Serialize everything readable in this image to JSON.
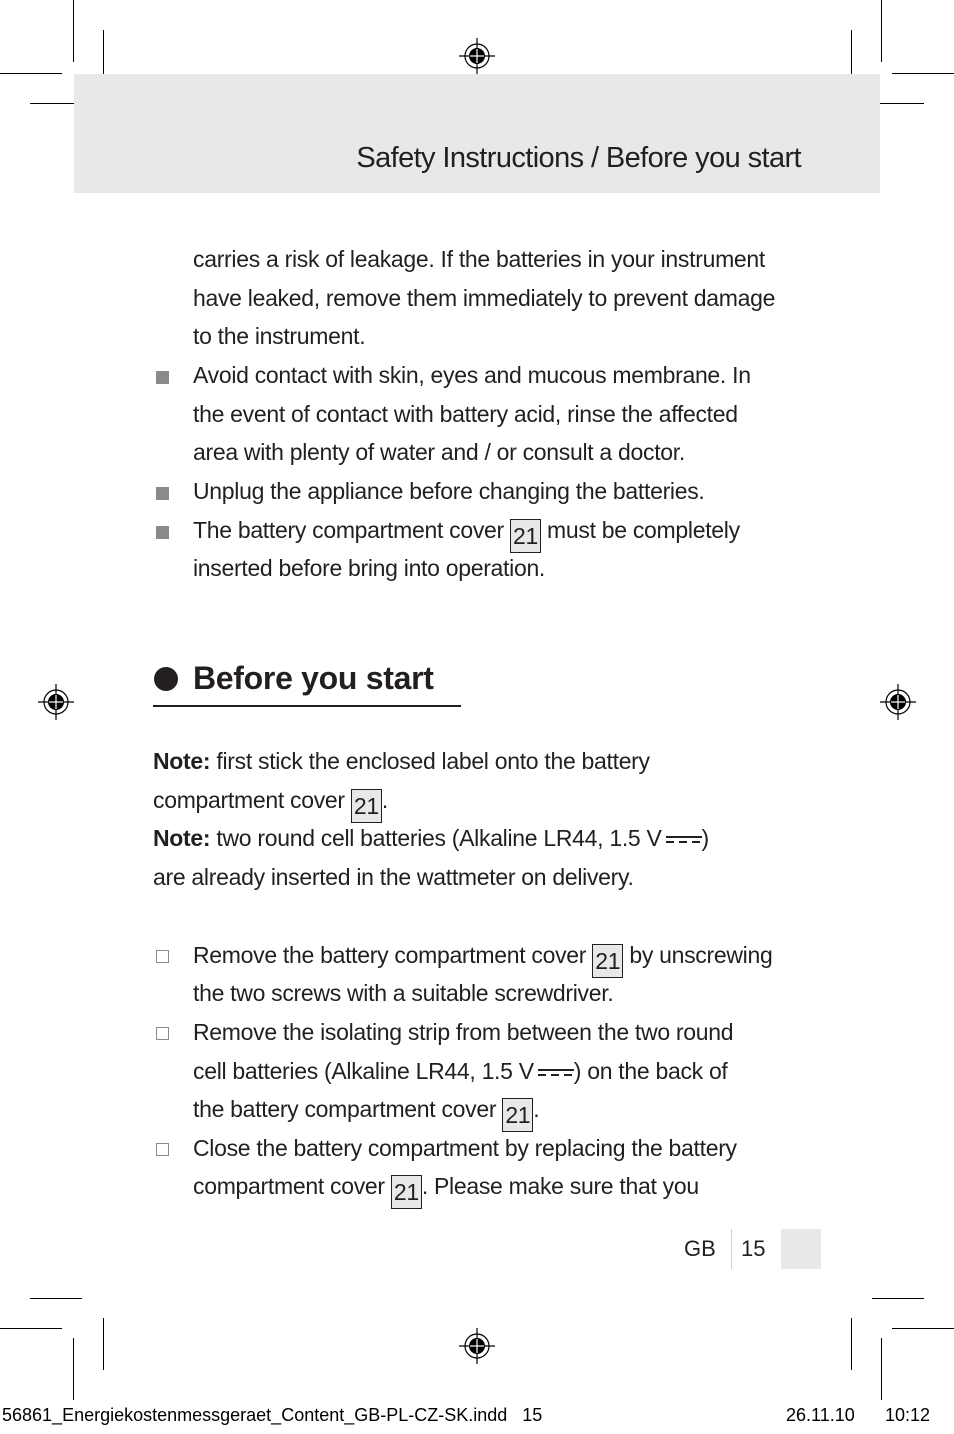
{
  "header": {
    "title": "Safety Instructions / Before you start"
  },
  "safety_continued": {
    "intro_lines": [
      "carries a risk of leakage. If the batteries in your instrument",
      "have leaked, remove them immediately to prevent damage",
      "to the instrument."
    ],
    "bullets": [
      {
        "lines": [
          "Avoid contact with skin, eyes and mucous membrane. In",
          "the event of contact with battery acid, rinse the affected",
          "area with plenty of water and / or consult a doctor."
        ]
      },
      {
        "lines": [
          "Unplug the appliance before changing the batteries."
        ]
      },
      {
        "line1_before": "The battery compartment cover",
        "ref": "21",
        "line1_after": "must be completely",
        "line2": "inserted before bring into operation."
      }
    ]
  },
  "section": {
    "title": "Before you start",
    "note1": {
      "label": "Note:",
      "line1": "first stick the enclosed label onto the battery",
      "line2_before": "compartment cover",
      "ref": "21",
      "line2_after": "."
    },
    "note2": {
      "label": "Note:",
      "line1": "two round cell batteries (Alkaline LR44, 1.5 V",
      "line1_after": ")",
      "line2": "are already inserted in the wattmeter on delivery."
    },
    "steps": [
      {
        "l1_before": "Remove the battery compartment cover",
        "ref": "21",
        "l1_after": "by unscrewing",
        "l2": "the two screws with a suitable screwdriver."
      },
      {
        "l1": "Remove the isolating strip from between the two round",
        "l2_before": "cell batteries (Alkaline LR44, 1.5 V",
        "l2_after": ") on the back of",
        "l3_before": "the battery compartment cover",
        "ref": "21",
        "l3_after": "."
      },
      {
        "l1": "Close the battery compartment by replacing the battery",
        "l2_before": "compartment cover",
        "ref": "21",
        "l2_after": ". Please make sure that you"
      }
    ]
  },
  "footer": {
    "language": "GB",
    "page_number": "15"
  },
  "slug": {
    "filename": "56861_Energiekostenmessgeraet_Content_GB-PL-CZ-SK.indd   15",
    "date": "26.11.10",
    "time": "10:12"
  }
}
